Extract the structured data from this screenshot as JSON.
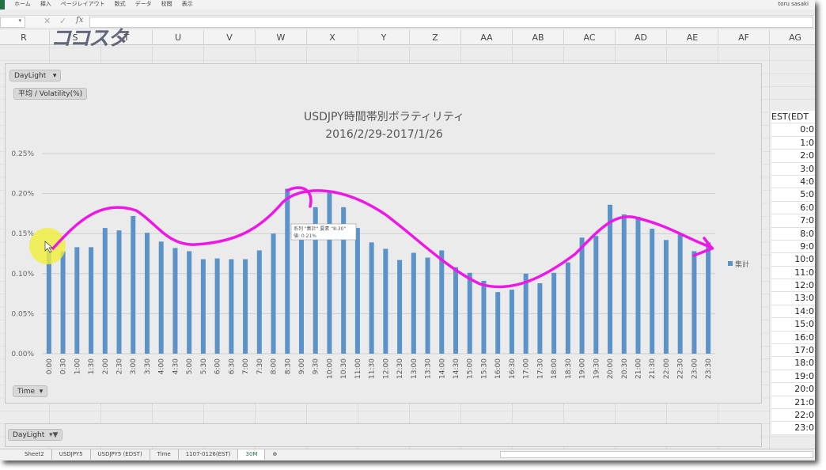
{
  "ribbon": {
    "tabs": [
      "ホーム",
      "挿入",
      "ページレイアウト",
      "数式",
      "データ",
      "校閲",
      "表示"
    ],
    "user": "toru sasaki"
  },
  "formula_bar": {
    "cancel_icon": "x-icon",
    "enter_icon": "check-icon",
    "fx": "fx"
  },
  "logo": "ココスタ",
  "columns": [
    "R",
    "S",
    "T",
    "U",
    "V",
    "W",
    "X",
    "Y",
    "Z",
    "AA",
    "AB",
    "AC",
    "AD",
    "AE",
    "AF",
    "AG"
  ],
  "pivot": {
    "filter_label": "DayLight",
    "value_label": "平均 / Volatility(%)",
    "axis_label": "Time",
    "filter2_label": "DayLight"
  },
  "colors": {
    "bar": "#5b93c9",
    "annotation": "#ee18e6",
    "highlight": "#f3ef3a"
  },
  "chart_data": {
    "type": "bar",
    "title": "USDJPY時間帯別ボラティリティ",
    "subtitle": "2016/2/29-2017/1/26",
    "xlabel": "",
    "ylabel": "",
    "ylim": [
      0,
      0.25
    ],
    "yticks": [
      "0.00%",
      "0.05%",
      "0.10%",
      "0.15%",
      "0.20%",
      "0.25%"
    ],
    "grid": true,
    "legend_position": "right",
    "series": [
      {
        "name": "集計",
        "values": [
          0.132,
          0.128,
          0.133,
          0.133,
          0.157,
          0.154,
          0.172,
          0.151,
          0.14,
          0.132,
          0.128,
          0.118,
          0.119,
          0.118,
          0.118,
          0.129,
          0.15,
          0.206,
          0.162,
          0.183,
          0.202,
          0.183,
          0.157,
          0.139,
          0.131,
          0.117,
          0.126,
          0.12,
          0.129,
          0.108,
          0.101,
          0.091,
          0.077,
          0.08,
          0.1,
          0.088,
          0.101,
          0.114,
          0.145,
          0.147,
          0.186,
          0.174,
          0.171,
          0.156,
          0.142,
          0.15,
          0.128,
          0.139
        ]
      }
    ],
    "categories": [
      "0:00",
      "0:30",
      "1:00",
      "1:30",
      "2:00",
      "2:30",
      "3:00",
      "3:30",
      "4:00",
      "4:30",
      "5:00",
      "5:30",
      "6:00",
      "6:30",
      "7:00",
      "7:30",
      "8:00",
      "8:30",
      "9:00",
      "9:30",
      "10:00",
      "10:30",
      "11:00",
      "11:30",
      "12:00",
      "12:30",
      "13:00",
      "13:30",
      "14:00",
      "14:30",
      "15:00",
      "15:30",
      "16:00",
      "16:30",
      "17:00",
      "17:30",
      "18:00",
      "18:30",
      "19:00",
      "19:30",
      "20:00",
      "20:30",
      "21:00",
      "21:30",
      "22:00",
      "22:30",
      "23:00",
      "23:30"
    ],
    "tooltip": {
      "line1": "系列 \"集計\" 要素 \"8:30\"",
      "line2": "値: 0.21%"
    }
  },
  "est_column": {
    "header": "EST(EDT",
    "rows": [
      "0:0",
      "1:0",
      "2:0",
      "3:0",
      "4:0",
      "5:0",
      "6:0",
      "7:0",
      "8:0",
      "9:0",
      "10:0",
      "11:0",
      "12:0",
      "13:0",
      "14:0",
      "15:0",
      "16:0",
      "17:0",
      "18:0",
      "19:0",
      "20:0",
      "21:0",
      "22:0",
      "23:0"
    ]
  },
  "sheet_tabs": [
    "Sheet2",
    "USDJPY5",
    "USDJPY5 (EDST)",
    "Time",
    "1107-0126(EST)",
    "30M"
  ],
  "active_tab": "30M"
}
